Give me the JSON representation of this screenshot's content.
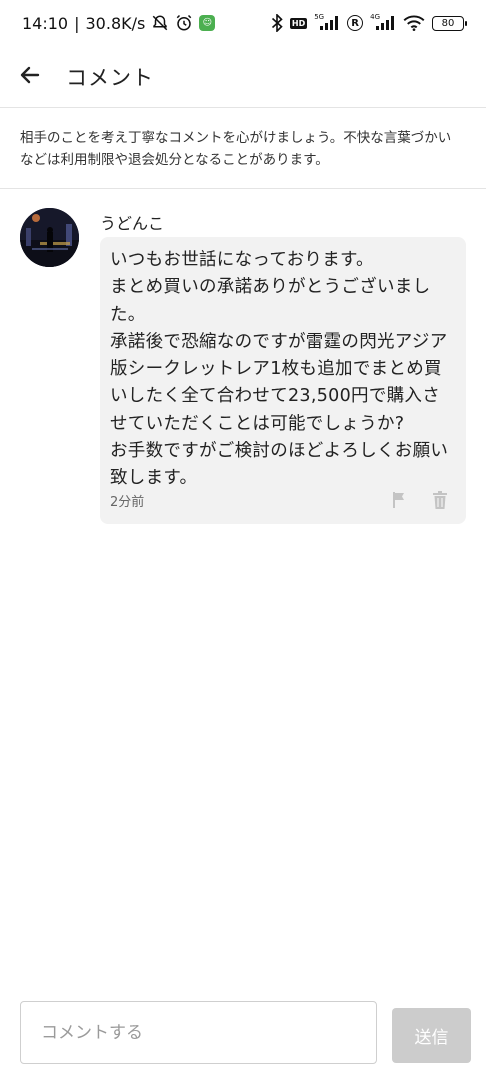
{
  "status_bar": {
    "time": "14:10",
    "separator": "|",
    "speed": "30.8K/s",
    "hd_label": "HD",
    "net1": "5G",
    "r_label": "R",
    "net2": "4G",
    "battery": "80",
    "icons": [
      "mute-icon",
      "alarm-icon",
      "app-badge-icon",
      "bluetooth-icon",
      "signal-icon",
      "wifi-icon",
      "battery-icon"
    ]
  },
  "header": {
    "title": "コメント",
    "back_icon": "back-arrow-icon"
  },
  "notice": {
    "text": "相手のことを考え丁寧なコメントを心がけましょう。不快な言葉づかいなどは利用制限や退会処分となることがあります。"
  },
  "comments": [
    {
      "username": "うどんこ",
      "text": "いつもお世話になっております。\nまとめ買いの承諾ありがとうございました。\n承諾後で恐縮なのですが雷霆の閃光アジア版シークレットレア1枚も追加でまとめ買いしたく全て合わせて23,500円で購入させていただくことは可能でしょうか?\nお手数ですがご検討のほどよろしくお願い致します。",
      "time": "2分前",
      "actions": [
        "flag-icon",
        "trash-icon"
      ]
    }
  ],
  "composer": {
    "placeholder": "コメントする",
    "value": "",
    "send_label": "送信"
  },
  "colors": {
    "bubble": "#f2f2f2",
    "send_disabled": "#cccccc",
    "divider": "#e4e4e4"
  }
}
